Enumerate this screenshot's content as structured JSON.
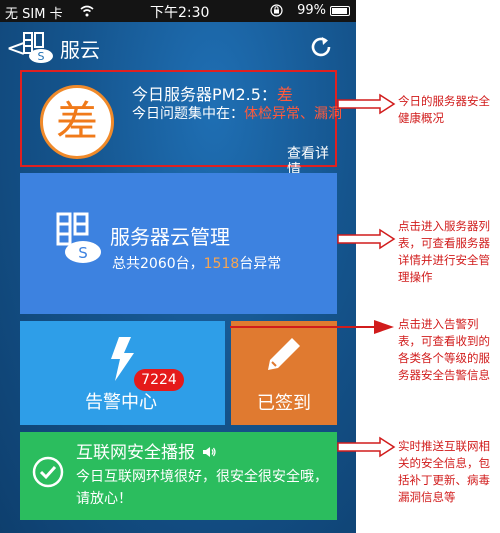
{
  "status_bar": {
    "carrier": "无 SIM 卡",
    "time": "下午2:30",
    "battery": "99%"
  },
  "nav": {
    "back": "<",
    "title": "服云"
  },
  "health": {
    "grade": "差",
    "pm_label": "今日服务器PM2.5：",
    "pm_value": "差",
    "issue_label": "今日问题集中在：",
    "issue_value": "体检异常、漏洞",
    "detail_link": "查看详情"
  },
  "server": {
    "title": "服务器云管理",
    "total_prefix": "总共2060台，",
    "abnormal_count": "1518",
    "abnormal_suffix": "台异常"
  },
  "alarm": {
    "label": "告警中心",
    "badge": "7224"
  },
  "signin": {
    "label": "已签到"
  },
  "news": {
    "title": "互联网安全播报",
    "body": "今日互联网环境很好，很安全很安全哦，请放心！"
  },
  "annotations": {
    "a1": "今日的服务器安全健康概况",
    "a2": "点击进入服务器列表，可查看服务器详情并进行安全管理操作",
    "a3": "点击进入告警列表，可查看收到的各类各个等级的服务器安全告警信息",
    "a4": "实时推送互联网相关的安全信息，包括补丁更新、病毒漏洞信息等"
  },
  "colors": {
    "health_border": "#e02020",
    "server_card": "#3d82e0",
    "alarm_card": "#2e9ee8",
    "signin_card": "#e07a30",
    "news_card": "#2bbd5e",
    "annotation": "#d11c1c"
  }
}
